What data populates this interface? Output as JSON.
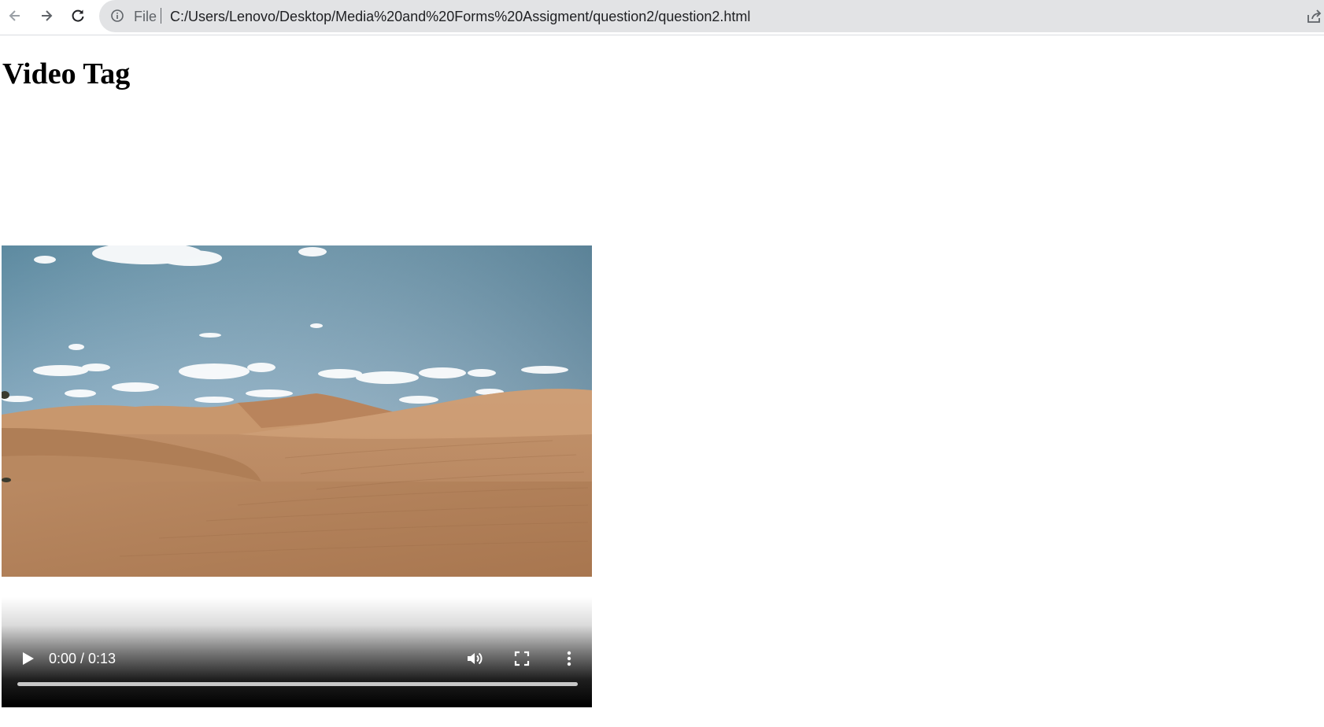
{
  "browser": {
    "scheme_label": "File",
    "url": "C:/Users/Lenovo/Desktop/Media%20and%20Forms%20Assigment/question2/question2.html",
    "icons": [
      "back-arrow-icon",
      "forward-arrow-icon",
      "reload-icon",
      "info-icon",
      "share-icon"
    ]
  },
  "page": {
    "heading": "Video Tag"
  },
  "video": {
    "time": "0:00 / 0:13",
    "progress_fraction": 0,
    "poster_description_colors": {
      "sky_top": "#4f7c93",
      "sky_bottom": "#a9c3d4",
      "sand_light": "#c99a72",
      "sand_dark": "#a87450"
    },
    "control_icons": [
      "play-icon",
      "volume-icon",
      "fullscreen-icon",
      "more-options-icon"
    ]
  }
}
